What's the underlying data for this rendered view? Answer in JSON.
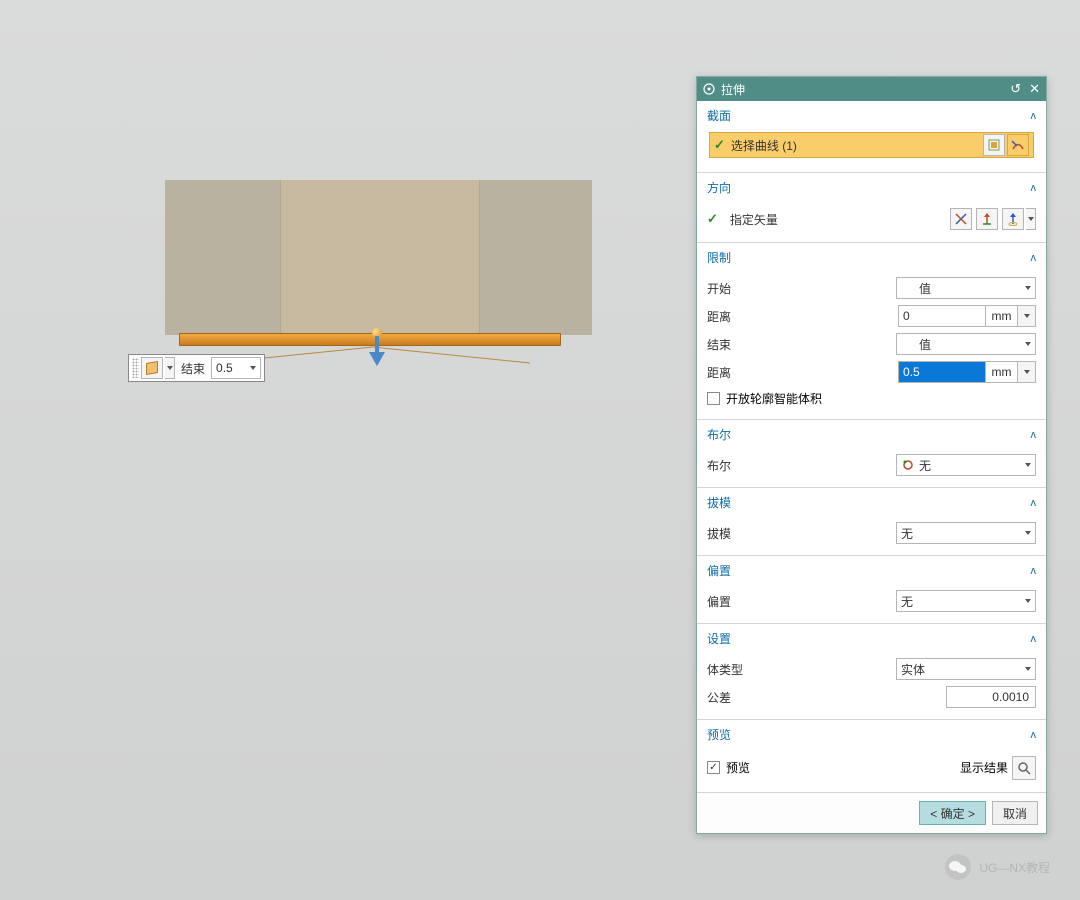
{
  "dialog": {
    "title": "拉伸",
    "section_profile": {
      "title": "截面",
      "select_curve": "选择曲线 (1)"
    },
    "section_direction": {
      "title": "方向",
      "specify_vector": "指定矢量"
    },
    "section_limits": {
      "title": "限制",
      "start_label": "开始",
      "start_type": "值",
      "start_dist_label": "距离",
      "start_dist_value": "0",
      "start_unit": "mm",
      "end_label": "结束",
      "end_type": "值",
      "end_dist_label": "距离",
      "end_dist_value": "0.5",
      "end_unit": "mm",
      "open_profile": "开放轮廓智能体积"
    },
    "section_bool": {
      "title": "布尔",
      "label": "布尔",
      "value": "无"
    },
    "section_draft": {
      "title": "拔模",
      "label": "拔模",
      "value": "无"
    },
    "section_offset": {
      "title": "偏置",
      "label": "偏置",
      "value": "无"
    },
    "section_settings": {
      "title": "设置",
      "body_type_label": "体类型",
      "body_type_value": "实体",
      "tol_label": "公差",
      "tol_value": "0.0010"
    },
    "section_preview": {
      "title": "预览",
      "checkbox": "预览",
      "show_result": "显示结果"
    },
    "footer": {
      "ok": "< 确定 >",
      "cancel": "取消"
    }
  },
  "float_tool": {
    "label": "结束",
    "value": "0.5"
  },
  "watermark": "UG—NX教程"
}
